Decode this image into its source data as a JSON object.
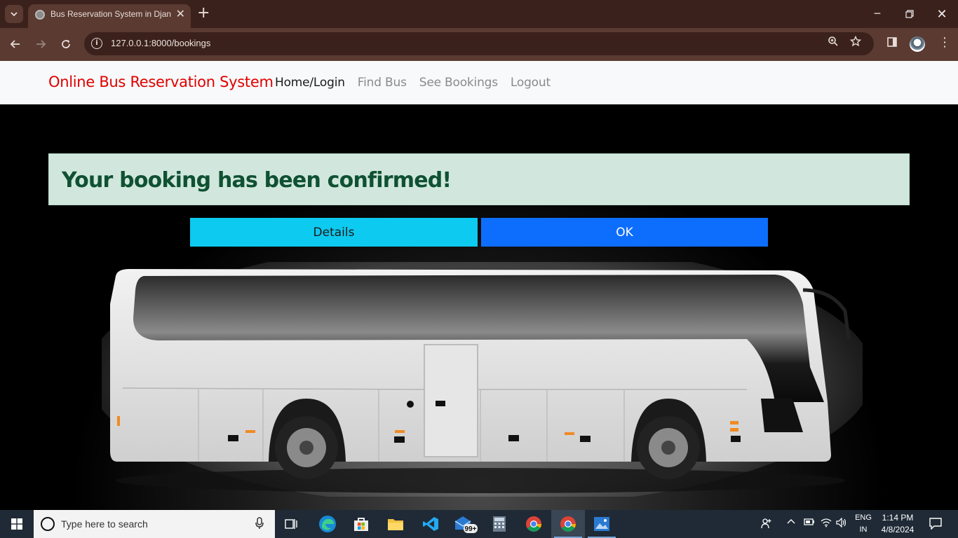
{
  "browser": {
    "tab_title": "Bus Reservation System in Django",
    "url": "127.0.0.1:8000/bookings"
  },
  "site": {
    "brand": "Online Bus Reservation System",
    "nav": [
      {
        "label": "Home/Login",
        "active": true
      },
      {
        "label": "Find Bus",
        "active": false
      },
      {
        "label": "See Bookings",
        "active": false
      },
      {
        "label": "Logout",
        "active": false
      }
    ]
  },
  "alert": {
    "message": "Your booking has been confirmed!"
  },
  "buttons": {
    "details": "Details",
    "ok": "OK"
  },
  "taskbar": {
    "search_placeholder": "Type here to search",
    "mail_badge": "99+",
    "language": "ENG",
    "region": "IN",
    "time": "1:14 PM",
    "date": "4/8/2024"
  },
  "colors": {
    "brand": "#e00000",
    "alert_bg": "#d1e7dd",
    "alert_text": "#0f5132",
    "details_btn": "#0dcaf0",
    "ok_btn": "#0d6efd"
  }
}
